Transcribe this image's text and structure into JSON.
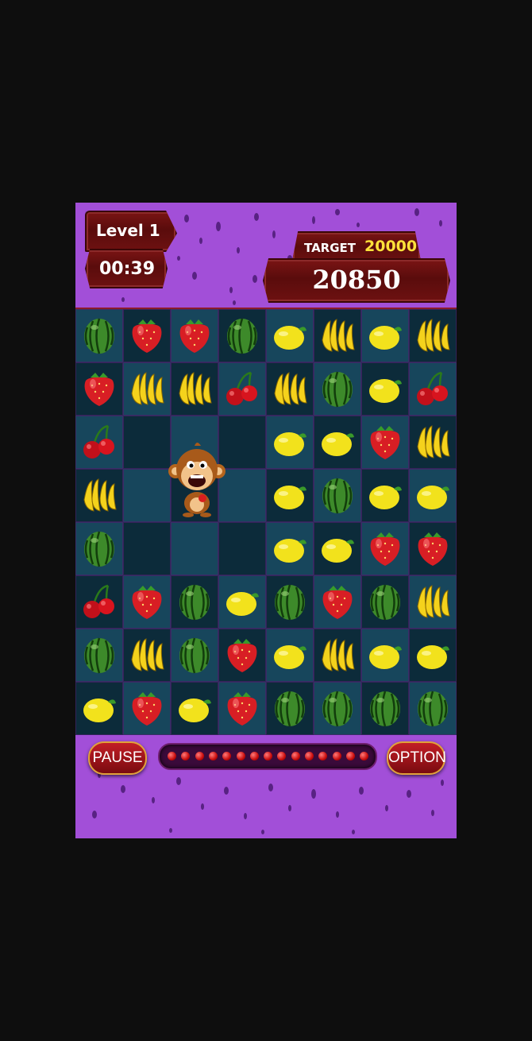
{
  "hud": {
    "level_label": "Level 1",
    "timer": "00:39",
    "target_label": "TARGET",
    "target_value": "20000",
    "score": "20850"
  },
  "controls": {
    "pause_label": "PAUSE",
    "option_label": "OPTION"
  },
  "progress": {
    "pip_count": 15,
    "fill": 1.0
  },
  "board": {
    "rows": 8,
    "cols": 8,
    "grid": [
      [
        "watermelon",
        "strawberry",
        "strawberry",
        "watermelon",
        "lemon",
        "banana",
        "lemon",
        "banana"
      ],
      [
        "strawberry",
        "banana",
        "banana",
        "cherry",
        "banana",
        "watermelon",
        "lemon",
        "cherry"
      ],
      [
        "cherry",
        "empty",
        "empty",
        "empty",
        "lemon",
        "lemon",
        "strawberry",
        "banana"
      ],
      [
        "banana",
        "empty",
        "empty",
        "empty",
        "lemon",
        "watermelon",
        "lemon",
        "lemon"
      ],
      [
        "watermelon",
        "empty",
        "empty",
        "empty",
        "lemon",
        "lemon",
        "strawberry",
        "strawberry"
      ],
      [
        "cherry",
        "strawberry",
        "watermelon",
        "lemon",
        "watermelon",
        "strawberry",
        "watermelon",
        "banana"
      ],
      [
        "watermelon",
        "banana",
        "watermelon",
        "strawberry",
        "lemon",
        "banana",
        "lemon",
        "lemon"
      ],
      [
        "lemon",
        "strawberry",
        "lemon",
        "strawberry",
        "watermelon",
        "watermelon",
        "watermelon",
        "watermelon"
      ]
    ],
    "monkey_cell": [
      3,
      2
    ]
  },
  "colors": {
    "background": "#a24fd8",
    "wood": "#6a1010",
    "target_value": "#ffe23a"
  }
}
